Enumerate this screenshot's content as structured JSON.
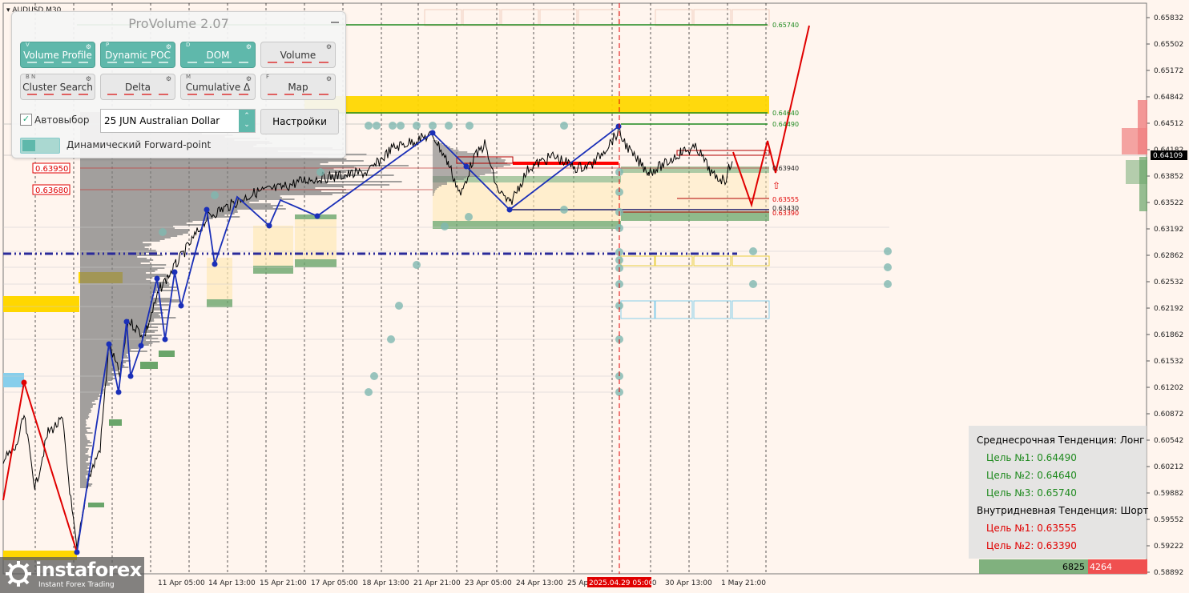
{
  "symbol": "AUDUSD,M30",
  "colors": {
    "background": "#fff5ee",
    "price_line": "#000000",
    "zigzag_up": "#1a2fb8",
    "zigzag_red": "#e00000",
    "target_green": "#1f8a1f",
    "target_red": "#e00000",
    "yellow_zone": "#ffd700",
    "green_zone": "#6aa56a",
    "teal_dot": "#7fb8b0"
  },
  "price_axis": {
    "ticks": [
      "0.65832",
      "0.65502",
      "0.65172",
      "0.64842",
      "0.64512",
      "0.64182",
      "0.63852",
      "0.63522",
      "0.63192",
      "0.62862",
      "0.62532",
      "0.62192",
      "0.61862",
      "0.61532",
      "0.61202",
      "0.60872",
      "0.60542",
      "0.60212",
      "0.59882",
      "0.59552",
      "0.59222",
      "0.58892"
    ],
    "current_price": "0.64109"
  },
  "time_axis": {
    "labels": [
      "11 Apr 05:00",
      "14 Apr 13:00",
      "15 Apr 21:00",
      "17 Apr 05:00",
      "18 Apr 13:00",
      "21 Apr 21:00",
      "23 Apr 05:00",
      "24 Apr 13:00",
      "25 Ap",
      "30 Apr 13:00",
      "1 May 21:00",
      ":00"
    ],
    "highlight": "2025.04.29 05:00"
  },
  "level_labels": {
    "l65740": "0.65740",
    "l64640": "0.64640",
    "l64490": "0.64490",
    "l63950": "0.63950",
    "l63680": "0.63680",
    "l63940": "0.63940",
    "l63555": "0.63555",
    "l63430": "0.63430",
    "l63390": "0.63390"
  },
  "provolume": {
    "title": "ProVolume 2.07",
    "buttons": [
      {
        "key": "V",
        "label": "Volume Profile",
        "active": true
      },
      {
        "key": "P",
        "label": "Dynamic POC",
        "active": true
      },
      {
        "key": "D",
        "label": "DOM",
        "active": true
      },
      {
        "key": "",
        "label": "Volume",
        "active": false
      },
      {
        "key": "B N",
        "label": "Cluster Search",
        "active": false
      },
      {
        "key": "",
        "label": "Delta",
        "active": false
      },
      {
        "key": "M",
        "label": "Cumulative Δ",
        "active": false
      },
      {
        "key": "F",
        "label": "Map",
        "active": false
      }
    ],
    "auto_select_label": "Автовыбор",
    "auto_select_checked": true,
    "instrument": "25 JUN Australian Dollar",
    "settings_label": "Настройки",
    "forward_label": "Динамический Forward-point"
  },
  "trend_panel": {
    "medium_title": "Среднесрочная Тенденция: Лонг",
    "medium_targets": [
      "Цель №1: 0.64490",
      "Цель №2: 0.64640",
      "Цель №3: 0.65740"
    ],
    "intraday_title": "Внутридневная Тенденция: Шорт",
    "intraday_targets": [
      "Цель №1: 0.63555",
      "Цель №2: 0.63390"
    ]
  },
  "volume_bar": {
    "buy": "6825",
    "sell": "4264"
  },
  "logo": {
    "name": "instaforex",
    "tagline": "Instant Forex Trading"
  }
}
